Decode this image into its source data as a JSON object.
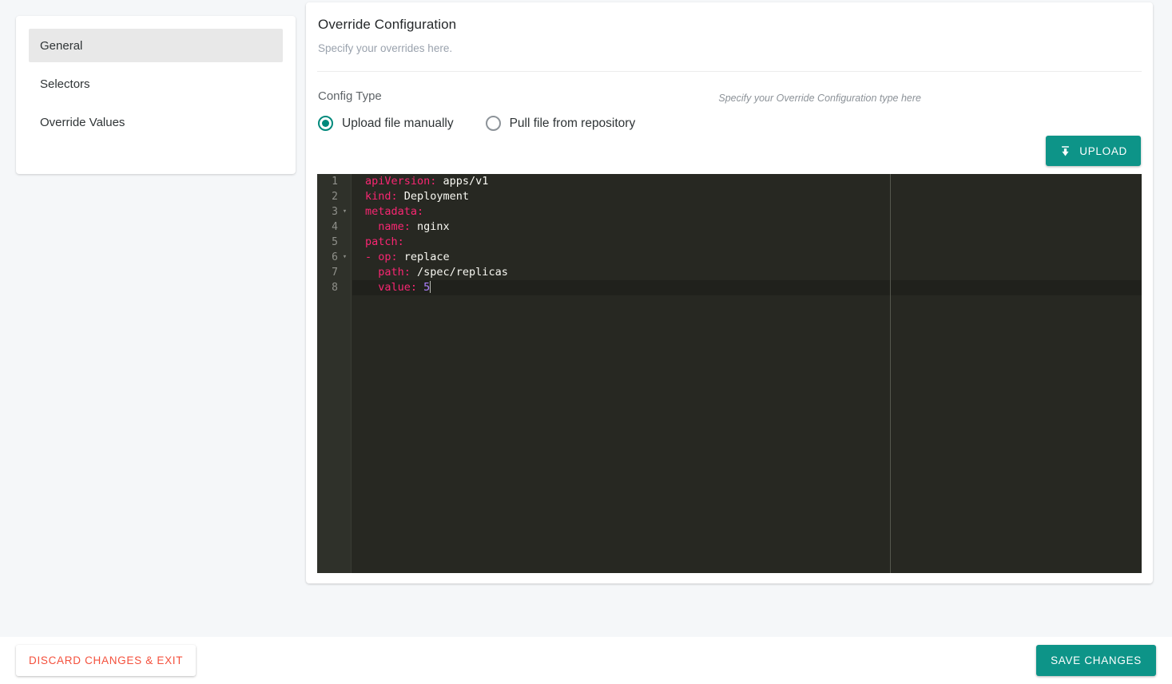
{
  "sidebar": {
    "items": [
      {
        "label": "General",
        "active": true
      },
      {
        "label": "Selectors",
        "active": false
      },
      {
        "label": "Override Values",
        "active": false
      }
    ]
  },
  "main": {
    "title": "Override Configuration",
    "subtitle": "Specify your overrides here.",
    "config_type": {
      "label": "Config Type",
      "hint": "Specify your Override Configuration type here",
      "options": [
        {
          "label": "Upload file manually",
          "selected": true
        },
        {
          "label": "Pull file from repository",
          "selected": false
        }
      ]
    },
    "upload_button": {
      "label": "UPLOAD",
      "icon": "upload-icon"
    }
  },
  "editor": {
    "lines": [
      {
        "num": "1",
        "fold": false,
        "tokens": [
          {
            "t": "apiVersion:",
            "c": "key"
          },
          {
            "t": " apps/v1",
            "c": "plain"
          }
        ]
      },
      {
        "num": "2",
        "fold": false,
        "tokens": [
          {
            "t": "kind:",
            "c": "key"
          },
          {
            "t": " Deployment",
            "c": "plain"
          }
        ]
      },
      {
        "num": "3",
        "fold": true,
        "tokens": [
          {
            "t": "metadata:",
            "c": "key"
          }
        ]
      },
      {
        "num": "4",
        "fold": false,
        "tokens": [
          {
            "t": "  name:",
            "c": "key"
          },
          {
            "t": " nginx",
            "c": "plain"
          }
        ]
      },
      {
        "num": "5",
        "fold": false,
        "tokens": [
          {
            "t": "patch:",
            "c": "key"
          }
        ]
      },
      {
        "num": "6",
        "fold": true,
        "tokens": [
          {
            "t": "- ",
            "c": "punct"
          },
          {
            "t": "op:",
            "c": "key"
          },
          {
            "t": " replace",
            "c": "plain"
          }
        ]
      },
      {
        "num": "7",
        "fold": false,
        "tokens": [
          {
            "t": "  path:",
            "c": "key"
          },
          {
            "t": " /spec/replicas",
            "c": "plain"
          }
        ]
      },
      {
        "num": "8",
        "fold": false,
        "cursor": true,
        "tokens": [
          {
            "t": "  value:",
            "c": "key"
          },
          {
            "t": " ",
            "c": "plain"
          },
          {
            "t": "5",
            "c": "num"
          }
        ]
      }
    ],
    "active_line": 8,
    "colors": {
      "background": "#272822",
      "gutter": "#2f312a",
      "active_line": "#20211c",
      "key": "#f92672",
      "plain": "#f8f8f2",
      "number": "#ae81ff"
    }
  },
  "footer": {
    "discard_label": "DISCARD CHANGES & EXIT",
    "save_label": "SAVE CHANGES"
  },
  "theme": {
    "accent": "#0d9488",
    "danger": "#f4503c",
    "page_background": "#f5f7f9"
  }
}
